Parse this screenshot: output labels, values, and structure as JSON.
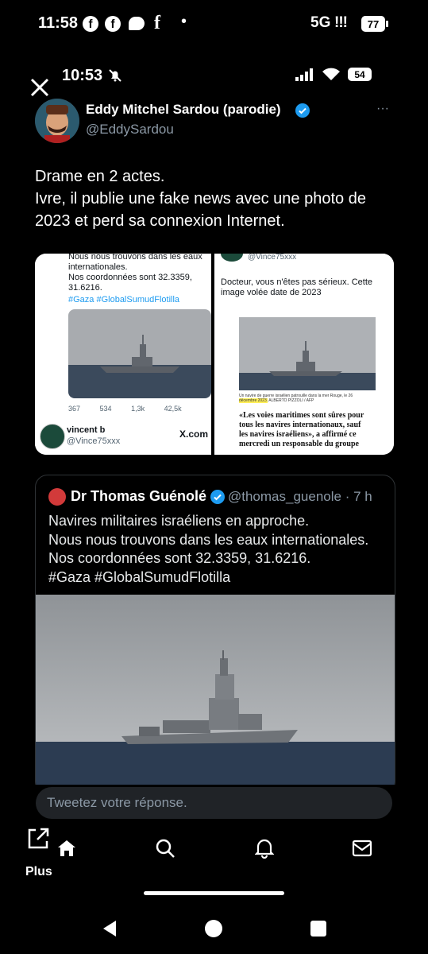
{
  "status_bar": {
    "time": "11:58",
    "network": "5G",
    "signal": "!!!",
    "battery": "77",
    "fb_glyph": "f",
    "dot": "•"
  },
  "inner_status": {
    "time": "10:53",
    "battery": "54"
  },
  "tweet": {
    "author_name": "Eddy Mitchel Sardou (parodie)",
    "author_handle": "@EddySardou",
    "text_line1": "Drame en 2 actes.",
    "text_line2": "Ivre, il publie une fake news avec une photo de 2023 et perd sa connexion Internet.",
    "more": "···"
  },
  "media": {
    "left": {
      "text1": "Nous nous trouvons dans les eaux internationales.",
      "text2": "Nos coordonnées sont 32.3359, 31.6216.",
      "hashtags": "#Gaza #GlobalSumudFlotilla",
      "stats": [
        "367",
        "534",
        "1,3k",
        "42,5k"
      ],
      "user_name": "vincent b",
      "user_handle": "@Vince75xxx",
      "site": "X.com"
    },
    "right": {
      "handle": "@Vince75xxx",
      "text": "Docteur, vous n'êtes pas sérieux. Cette image volée date de 2023",
      "caption1": "Un navire de guerre israélien patrouille dans la mer Rouge, le 26",
      "caption2": "décembre 2023.",
      "credit": "ALBERTO PIZZOLI / AFP",
      "quote": "«Les voies maritimes sont sûres pour tous les navires internationaux, sauf les navires israéliens», a affirmé ce mercredi un responsable du groupe"
    }
  },
  "quoted_tweet": {
    "name": "Dr Thomas Guénolé",
    "handle": "@thomas_guenole · 7 h",
    "line1": "Navires militaires israéliens en approche.",
    "line2": "Nous nous trouvons dans les eaux internationales.",
    "line3": "Nos coordonnées sont 32.3359, 31.6216.",
    "line4": "#Gaza #GlobalSumudFlotilla"
  },
  "reply": {
    "placeholder": "Tweetez votre réponse."
  },
  "bottom_nav": {
    "plus_label": "Plus",
    "icons": [
      "share-icon",
      "home-icon",
      "search-icon",
      "bell-icon",
      "mail-icon"
    ]
  },
  "colors": {
    "background": "#000000",
    "verified": "#1d9bf0",
    "muted": "#8b98a5",
    "reply_bg": "#202327"
  }
}
